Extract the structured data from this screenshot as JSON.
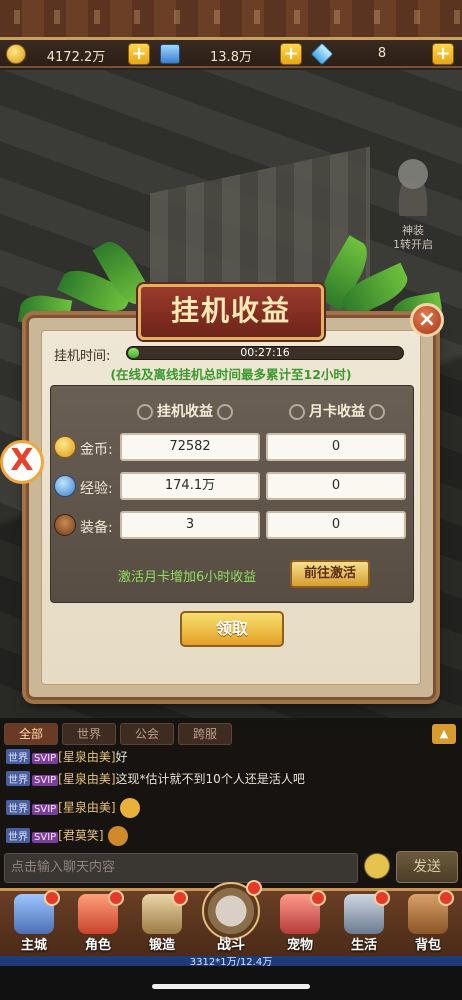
{
  "resources": {
    "gold": {
      "icon": "gold-coin-icon",
      "value": "4172.2万"
    },
    "materials": {
      "icon": "chest-icon",
      "value": "13.8万"
    },
    "diamonds": {
      "icon": "diamond-icon",
      "value": "8"
    },
    "plus_symbol": "+"
  },
  "scene": {
    "equip_label": "神装\n1转开启"
  },
  "side_badge": "X",
  "modal": {
    "title": "挂机收益",
    "close_symbol": "×",
    "time_label": "挂机时间:",
    "time_value": "00:27:16",
    "time_progress": 0.04,
    "notice": "(在线及离线挂机总时间最多累计至12小时)",
    "headers": {
      "idle": "挂机收益",
      "monthly": "月卡收益"
    },
    "rows": [
      {
        "icon": "gold-coin-icon",
        "label": "金币:",
        "idle": "72582",
        "monthly": "0"
      },
      {
        "icon": "exp-icon",
        "label": "经验:",
        "idle": "174.1万",
        "monthly": "0"
      },
      {
        "icon": "equipment-bag-icon",
        "label": "装备:",
        "idle": "3",
        "monthly": "0"
      }
    ],
    "promo_text": "激活月卡增加6小时收益",
    "activate_button": "前往激活",
    "claim_button": "领取"
  },
  "chat": {
    "tabs": [
      "全部",
      "世界",
      "公会",
      "跨服"
    ],
    "active_tab": 0,
    "messages": [
      {
        "channel": "世界",
        "vip": "SVIP",
        "name": "[星泉由美]",
        "text": "好"
      },
      {
        "channel": "世界",
        "vip": "SVIP",
        "name": "[星泉由美]",
        "text": "这现*估计就不到10个人还是活人吧"
      },
      {
        "channel": "世界",
        "vip": "SVIP",
        "name": "[星泉由美]",
        "text": ""
      },
      {
        "channel": "世界",
        "vip": "SVIP",
        "name": "[君莫笑]",
        "text": ""
      }
    ],
    "input_placeholder": "点击输入聊天内容",
    "send_button": "发送"
  },
  "nav": {
    "items": [
      {
        "icon": "castle-icon",
        "label": "主城"
      },
      {
        "icon": "hero-icon",
        "label": "角色"
      },
      {
        "icon": "anvil-icon",
        "label": "锻造"
      },
      {
        "icon": "crossed-swords-icon",
        "label": "战斗"
      },
      {
        "icon": "pet-icon",
        "label": "宠物"
      },
      {
        "icon": "tools-icon",
        "label": "生活"
      },
      {
        "icon": "backpack-icon",
        "label": "背包"
      }
    ],
    "power_text": "3312*1万/12.4万"
  }
}
